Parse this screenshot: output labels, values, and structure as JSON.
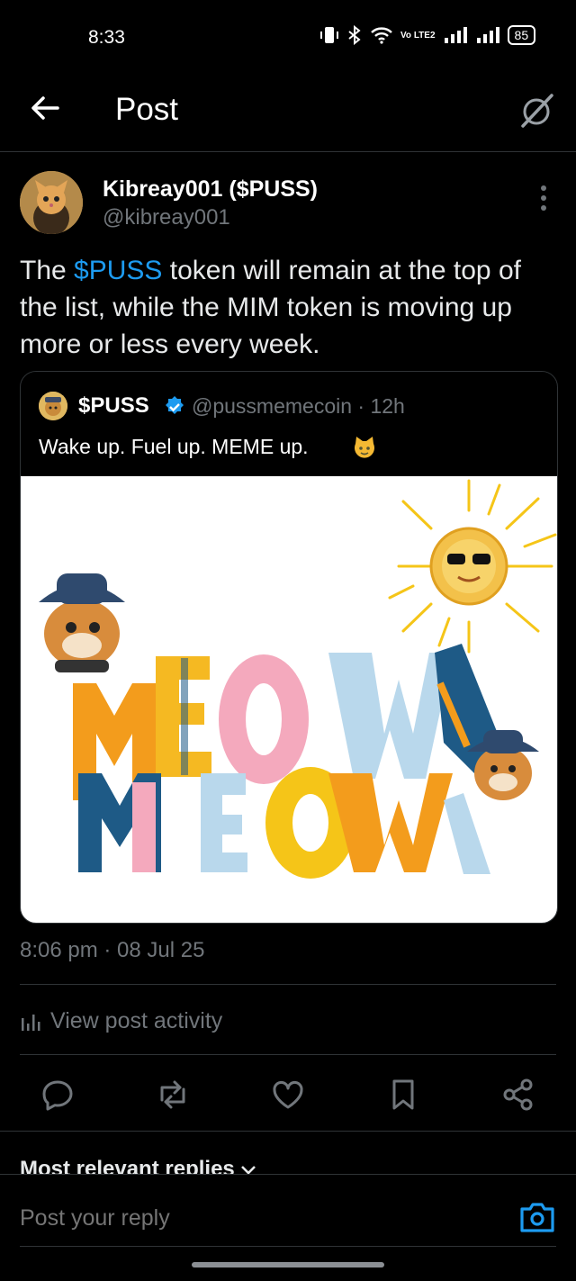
{
  "status_bar": {
    "time": "8:33",
    "battery": "85",
    "network": "Vo LTE2"
  },
  "header": {
    "title": "Post"
  },
  "author": {
    "name": "Kibreay001 ($PUSS)",
    "handle": "@kibreay001"
  },
  "post": {
    "text_before": "The ",
    "link": "$PUSS",
    "text_after": " token will remain at the top of the list, while the MIM token is moving up more or less every week."
  },
  "quote": {
    "name": "$PUSS",
    "handle": "@pussmemecoin · 12h",
    "text": "Wake up. Fuel up. MEME up.",
    "image_words": [
      "MEOW",
      "MEOW"
    ]
  },
  "timestamp": "8:06 pm · 08 Jul 25",
  "activity_label": "View post activity",
  "replies_sort": "Most relevant replies",
  "reply": {
    "placeholder": "Post your reply"
  },
  "colors": {
    "accent": "#1d9bf0",
    "background": "#000000",
    "secondary_text": "#71767b",
    "divider": "#2f3336"
  },
  "icons": [
    "back-arrow-icon",
    "grok-icon",
    "more-vertical-icon",
    "verified-badge-icon",
    "cat-emoji-icon",
    "chart-icon",
    "reply-icon",
    "repost-icon",
    "like-icon",
    "bookmark-icon",
    "share-icon",
    "chevron-down-icon",
    "camera-icon"
  ]
}
